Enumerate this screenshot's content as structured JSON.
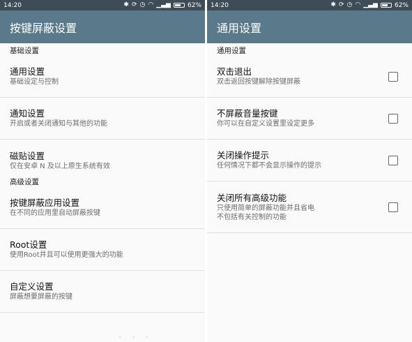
{
  "left": {
    "status": {
      "time": "14:20",
      "battery": "62%",
      "battery_level": 0.62
    },
    "title": "按键屏蔽设置",
    "sections": [
      {
        "header": "基础设置",
        "items": [
          {
            "title": "通用设置",
            "subtitle": "基础设定与控制"
          },
          {
            "title": "通知设置",
            "subtitle": "开启或者关闭通知与其他的功能"
          },
          {
            "title": "磁贴设置",
            "subtitle": "仅在安卓 N 及以上原生系统有效"
          }
        ]
      },
      {
        "header": "高级设置",
        "items": [
          {
            "title": "按键屏蔽应用设置",
            "subtitle": "在不同的应用里自动屏蔽按键"
          },
          {
            "title": "Root设置",
            "subtitle": "使用Root并且可以使用更强大的功能"
          },
          {
            "title": "自定义设置",
            "subtitle": "屏蔽想要屏蔽的按键"
          }
        ]
      }
    ]
  },
  "right": {
    "status": {
      "time": "14:20",
      "battery": "62%",
      "battery_level": 0.62
    },
    "title": "通用设置",
    "section_header": "通用设置",
    "items": [
      {
        "title": "双击退出",
        "subtitle": "双击返回按键解除按键屏蔽",
        "checked": false
      },
      {
        "title": "不屏蔽音量按键",
        "subtitle": "你可以在自定义设置里设定更多",
        "checked": false
      },
      {
        "title": "关闭操作提示",
        "subtitle": "任何情况下都不会显示操作的提示",
        "checked": false
      },
      {
        "title": "关闭所有高级功能",
        "subtitle": "只使用简单的屏蔽功能并且省电",
        "subtitle2": "不包括有关控制的功能",
        "checked": false
      }
    ]
  },
  "icons": [
    "bluetooth-icon",
    "sync-icon",
    "alarm-icon",
    "wifi-icon",
    "signal-icon",
    "battery-icon"
  ]
}
